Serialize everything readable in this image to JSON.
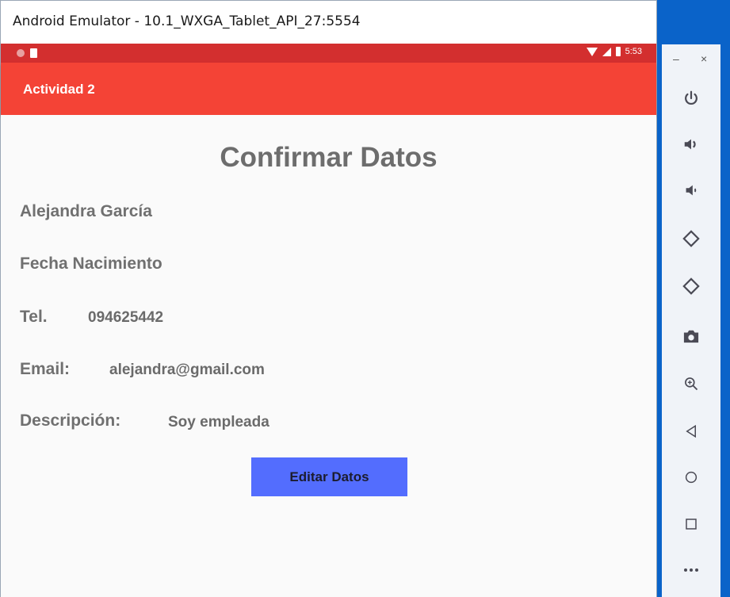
{
  "window": {
    "title": "Android Emulator - 10.1_WXGA_Tablet_API_27:5554"
  },
  "statusbar": {
    "time": "5:53"
  },
  "appbar": {
    "title": "Actividad 2"
  },
  "screen": {
    "heading": "Confirmar Datos",
    "name": "Alejandra García",
    "birth_label": "Fecha Nacimiento",
    "tel_label": "Tel.",
    "tel_value": "094625442",
    "email_label": "Email:",
    "email_value": "alejandra@gmail.com",
    "desc_label": "Descripción:",
    "desc_value": "Soy empleada",
    "edit_button": "Editar Datos"
  },
  "sidebar": {
    "minimize": "–",
    "close": "×",
    "icons": [
      "power-icon",
      "volume-up-icon",
      "volume-down-icon",
      "rotate-left-icon",
      "rotate-right-icon",
      "camera-icon",
      "zoom-icon",
      "back-icon",
      "home-icon",
      "overview-icon",
      "more-icon"
    ]
  },
  "colors": {
    "status": "#d32f2f",
    "appbar": "#f44336",
    "button": "#536dfe",
    "sidebar_accent": "#0a63c9"
  }
}
